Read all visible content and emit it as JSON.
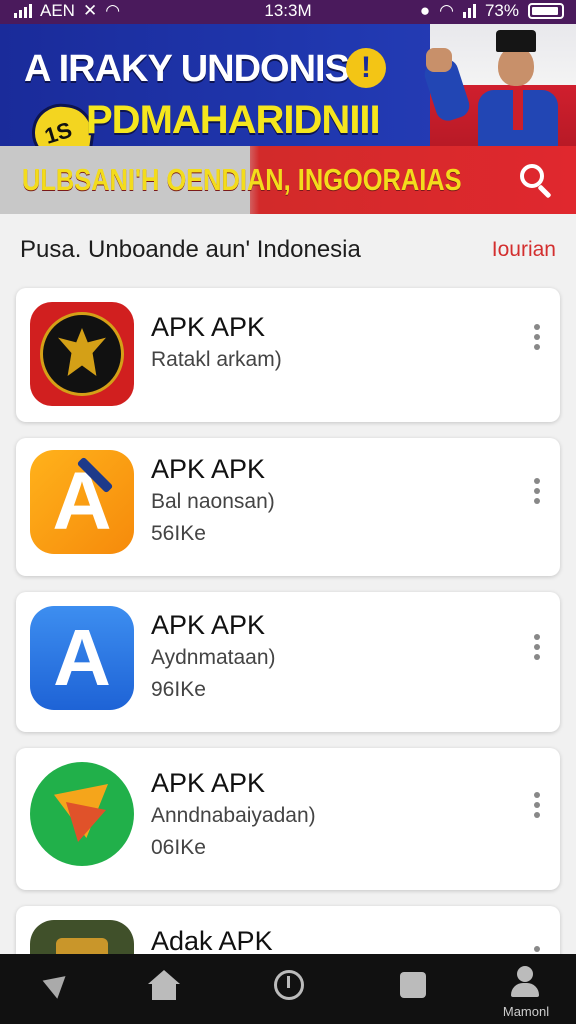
{
  "status_bar": {
    "carrier": "AEN",
    "time": "13:3M",
    "battery": "73%"
  },
  "banner": {
    "line1": "A IRAKY UNDONIS",
    "line2": "PDMAHARIDNIII",
    "line3": "ULBSANI'H OENDIAN, INGOORAIAS",
    "heart_text": "1S"
  },
  "section": {
    "title": "Pusa. Unboande aun' Indonesia",
    "link": "Iourian"
  },
  "apps": [
    {
      "name": "APK APK",
      "subtitle": "Ratakl arkam)",
      "size": "",
      "icon": "garuda-icon"
    },
    {
      "name": "APK APK",
      "subtitle": "Bal naonsan)",
      "size": "56IKe",
      "icon": "orange-a-icon"
    },
    {
      "name": "APK APK",
      "subtitle": "Aydnmataan)",
      "size": "96IKe",
      "icon": "blue-a-icon"
    },
    {
      "name": "APK APK",
      "subtitle": "Anndnabaiyadan)",
      "size": "06IKe",
      "icon": "green-arrow-icon"
    },
    {
      "name": "Adak APK",
      "subtitle": "",
      "size": "",
      "icon": "emblem-icon"
    }
  ],
  "bottom_nav": {
    "items": [
      {
        "icon": "back-icon",
        "label": ""
      },
      {
        "icon": "home-icon",
        "label": ""
      },
      {
        "icon": "power-icon",
        "label": ""
      },
      {
        "icon": "square-icon",
        "label": ""
      },
      {
        "icon": "profile-icon",
        "label": "Mamonl"
      }
    ]
  },
  "colors": {
    "status_bar": "#4a1a5c",
    "banner_blue": "#1a2b9a",
    "banner_yellow": "#f5e61e",
    "accent_red": "#d32f2f",
    "nav_bg": "#111111"
  }
}
